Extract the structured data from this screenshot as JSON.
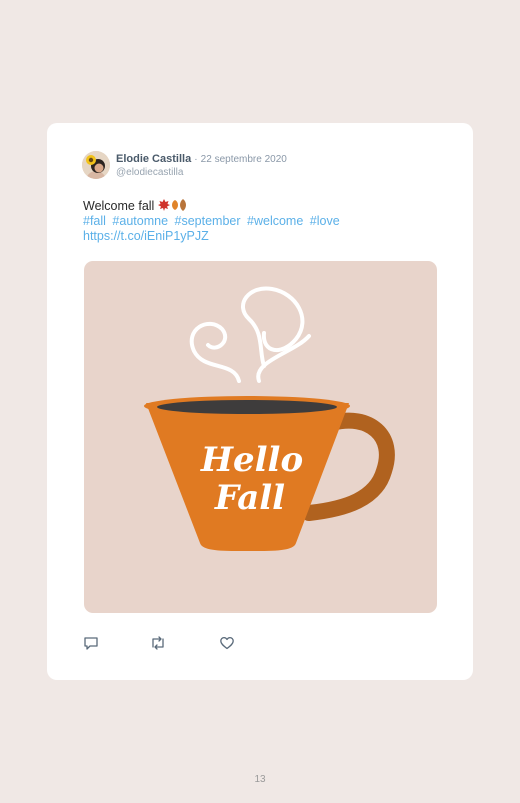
{
  "tweet": {
    "author_name": "Elodie Castilla",
    "separator": "·",
    "date": "22 septembre 2020",
    "handle": "@elodiecastilla",
    "text": "Welcome fall",
    "hashtags": [
      "#fall",
      "#automne",
      "#september",
      "#welcome",
      "#love"
    ],
    "link": "https://t.co/iEniP1yPJZ"
  },
  "media": {
    "cup_lines": [
      "Hello",
      "Fall"
    ]
  },
  "actions": [
    {
      "name": "reply-icon"
    },
    {
      "name": "retweet-icon"
    },
    {
      "name": "like-icon"
    }
  ],
  "page_number": "13",
  "colors": {
    "background": "#f0e8e5",
    "card": "#ffffff",
    "media_bg": "#e8d4cb",
    "cup": "#e07a22",
    "handle": "#b86a28",
    "link": "#5bb0e8"
  }
}
